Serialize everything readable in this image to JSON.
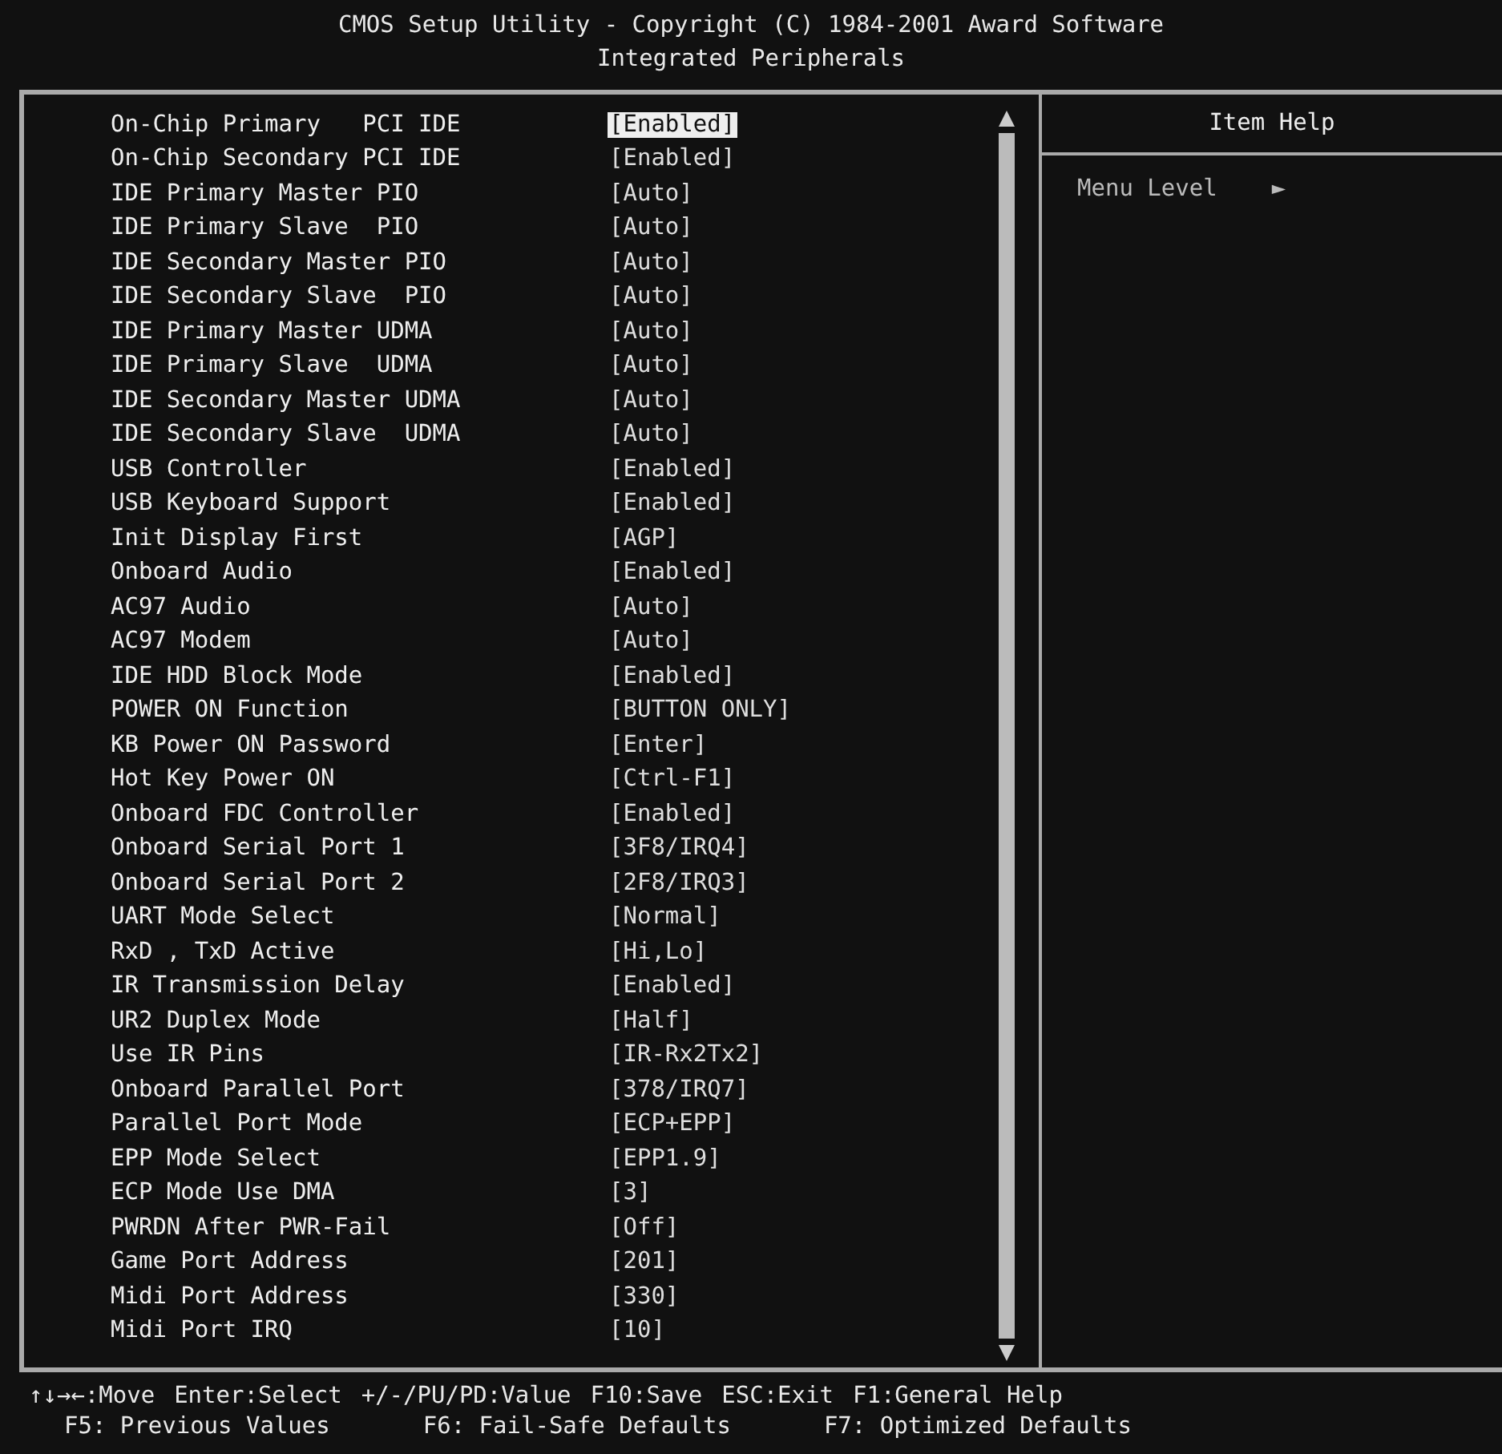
{
  "header": {
    "title": "CMOS Setup Utility - Copyright (C) 1984-2001 Award Software",
    "subtitle": "Integrated Peripherals"
  },
  "settings": [
    {
      "label": "On-Chip Primary   PCI IDE",
      "value": "[Enabled]",
      "selected": true
    },
    {
      "label": "On-Chip Secondary PCI IDE",
      "value": "[Enabled]",
      "selected": false
    },
    {
      "label": "IDE Primary Master PIO",
      "value": "[Auto]",
      "selected": false
    },
    {
      "label": "IDE Primary Slave  PIO",
      "value": "[Auto]",
      "selected": false
    },
    {
      "label": "IDE Secondary Master PIO",
      "value": "[Auto]",
      "selected": false
    },
    {
      "label": "IDE Secondary Slave  PIO",
      "value": "[Auto]",
      "selected": false
    },
    {
      "label": "IDE Primary Master UDMA",
      "value": "[Auto]",
      "selected": false
    },
    {
      "label": "IDE Primary Slave  UDMA",
      "value": "[Auto]",
      "selected": false
    },
    {
      "label": "IDE Secondary Master UDMA",
      "value": "[Auto]",
      "selected": false
    },
    {
      "label": "IDE Secondary Slave  UDMA",
      "value": "[Auto]",
      "selected": false
    },
    {
      "label": "USB Controller",
      "value": "[Enabled]",
      "selected": false
    },
    {
      "label": "USB Keyboard Support",
      "value": "[Enabled]",
      "selected": false
    },
    {
      "label": "Init Display First",
      "value": "[AGP]",
      "selected": false
    },
    {
      "label": "Onboard Audio",
      "value": "[Enabled]",
      "selected": false
    },
    {
      "label": "AC97 Audio",
      "value": "[Auto]",
      "selected": false
    },
    {
      "label": "AC97 Modem",
      "value": "[Auto]",
      "selected": false
    },
    {
      "label": "IDE HDD Block Mode",
      "value": "[Enabled]",
      "selected": false
    },
    {
      "label": "POWER ON Function",
      "value": "[BUTTON ONLY]",
      "selected": false
    },
    {
      "label": "KB Power ON Password",
      "value": "[Enter]",
      "selected": false
    },
    {
      "label": "Hot Key Power ON",
      "value": "[Ctrl-F1]",
      "selected": false
    },
    {
      "label": "Onboard FDC Controller",
      "value": "[Enabled]",
      "selected": false
    },
    {
      "label": "Onboard Serial Port 1",
      "value": "[3F8/IRQ4]",
      "selected": false
    },
    {
      "label": "Onboard Serial Port 2",
      "value": "[2F8/IRQ3]",
      "selected": false
    },
    {
      "label": "UART Mode Select",
      "value": "[Normal]",
      "selected": false
    },
    {
      "label": "RxD , TxD Active",
      "value": "[Hi,Lo]",
      "selected": false
    },
    {
      "label": "IR Transmission Delay",
      "value": "[Enabled]",
      "selected": false
    },
    {
      "label": "UR2 Duplex Mode",
      "value": "[Half]",
      "selected": false
    },
    {
      "label": "Use IR Pins",
      "value": "[IR-Rx2Tx2]",
      "selected": false
    },
    {
      "label": "Onboard Parallel Port",
      "value": "[378/IRQ7]",
      "selected": false
    },
    {
      "label": "Parallel Port Mode",
      "value": "[ECP+EPP]",
      "selected": false
    },
    {
      "label": "EPP Mode Select",
      "value": "[EPP1.9]",
      "selected": false
    },
    {
      "label": "ECP Mode Use DMA",
      "value": "[3]",
      "selected": false
    },
    {
      "label": "PWRDN After PWR-Fail",
      "value": "[Off]",
      "selected": false
    },
    {
      "label": "Game Port Address",
      "value": "[201]",
      "selected": false
    },
    {
      "label": "Midi Port Address",
      "value": "[330]",
      "selected": false
    },
    {
      "label": "Midi Port IRQ",
      "value": "[10]",
      "selected": false
    }
  ],
  "item_help": {
    "title": "Item Help",
    "menu_level": "Menu Level",
    "menu_level_marker": "►"
  },
  "footer": [
    [
      "↑↓→←:Move",
      "Enter:Select",
      "+/-/PU/PD:Value",
      "F10:Save",
      "ESC:Exit",
      "F1:General Help"
    ],
    [
      "F5: Previous Values",
      "F6: Fail-Safe Defaults",
      "F7: Optimized Defaults"
    ]
  ]
}
